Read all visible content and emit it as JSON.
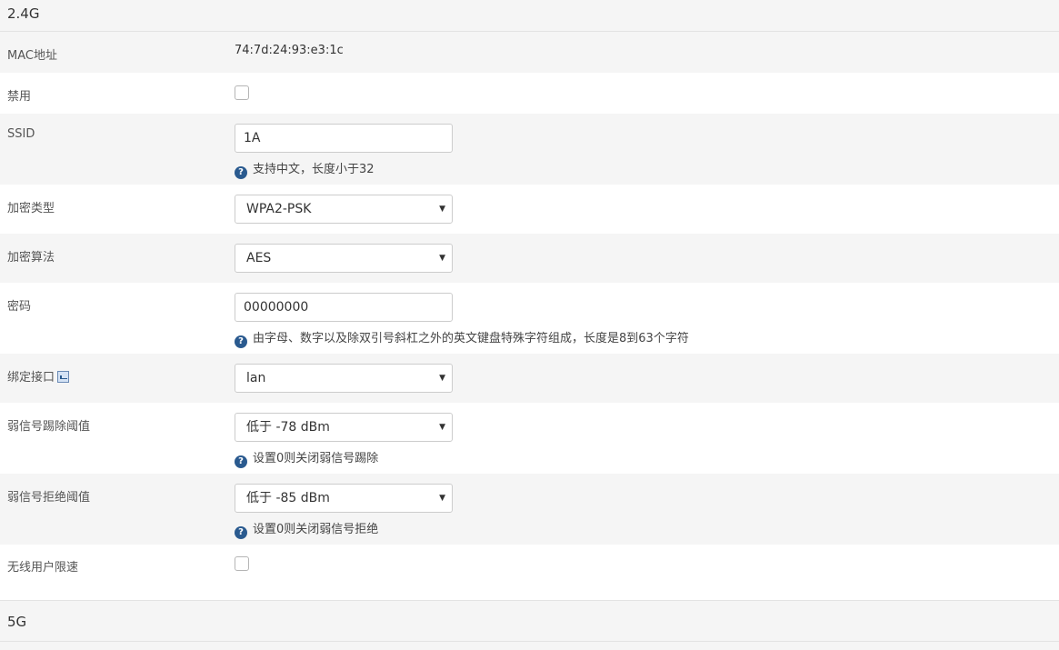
{
  "section_24g": {
    "title": "2.4G"
  },
  "section_5g": {
    "title": "5G"
  },
  "fields": {
    "mac": {
      "label": "MAC地址",
      "value": "74:7d:24:93:e3:1c"
    },
    "disable": {
      "label": "禁用",
      "checked": false
    },
    "ssid": {
      "label": "SSID",
      "value": "1A",
      "help": "支持中文，长度小于32"
    },
    "encryption_type": {
      "label": "加密类型",
      "value": "WPA2-PSK"
    },
    "encryption_algo": {
      "label": "加密算法",
      "value": "AES"
    },
    "password": {
      "label": "密码",
      "value": "00000000",
      "help": "由字母、数字以及除双引号斜杠之外的英文键盘特殊字符组成，长度是8到63个字符"
    },
    "bind_interface": {
      "label": "绑定接口",
      "value": "lan",
      "icon": "interface-link-icon"
    },
    "weak_kick": {
      "label": "弱信号踢除阈值",
      "value": "低于 -78 dBm",
      "help": "设置0则关闭弱信号踢除"
    },
    "weak_reject": {
      "label": "弱信号拒绝阈值",
      "value": "低于 -85 dBm",
      "help": "设置0则关闭弱信号拒绝"
    },
    "rate_limit": {
      "label": "无线用户限速",
      "checked": false
    }
  },
  "icons": {
    "help": "question-circle-icon",
    "dropdown": "caret-down-icon"
  },
  "colors": {
    "stripe": "#f5f5f5",
    "help_icon": "#2a5a8f",
    "border": "#cccccc"
  }
}
